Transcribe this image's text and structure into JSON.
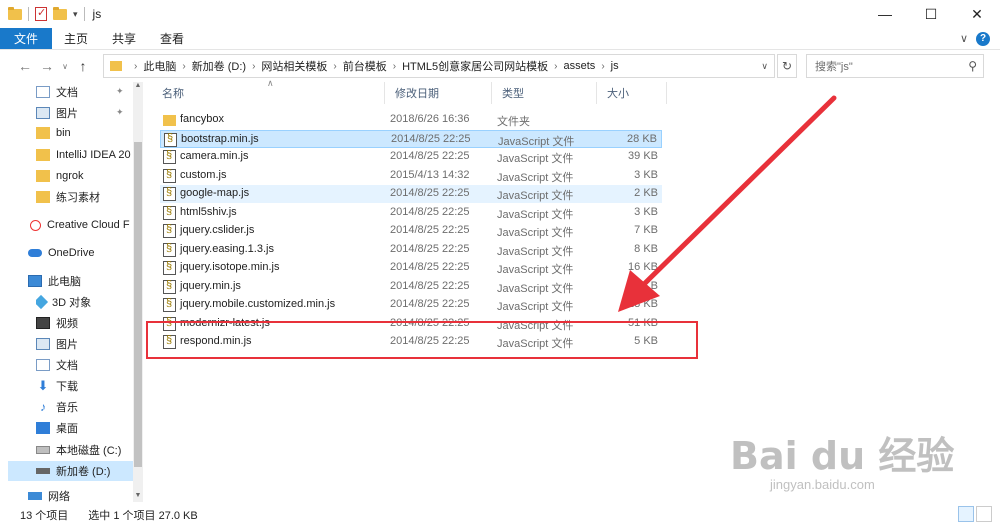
{
  "window": {
    "title": "js",
    "controls": {
      "minimize": "—",
      "maximize": "☐",
      "close": "✕"
    }
  },
  "ribbon": {
    "tabs": [
      "文件",
      "主页",
      "共享",
      "查看"
    ],
    "right_chevron": "∨",
    "help": "?"
  },
  "address": {
    "crumbs": [
      "此电脑",
      "新加卷 (D:)",
      "网站相关模板",
      "前台模板",
      "HTML5创意家居公司网站模板",
      "assets",
      "js"
    ],
    "search_placeholder": "搜索\"js\""
  },
  "sidebar": {
    "items": [
      {
        "label": "文档",
        "icon": "document-icon",
        "pinned": true
      },
      {
        "label": "图片",
        "icon": "pictures-icon",
        "pinned": true
      },
      {
        "label": "bin",
        "icon": "folder-icon"
      },
      {
        "label": "IntelliJ IDEA 20",
        "icon": "folder-icon"
      },
      {
        "label": "ngrok",
        "icon": "folder-icon"
      },
      {
        "label": "练习素材",
        "icon": "folder-icon"
      },
      {
        "label": "Creative Cloud F",
        "icon": "creative-cloud-icon"
      },
      {
        "label": "OneDrive",
        "icon": "onedrive-icon"
      },
      {
        "label": "此电脑",
        "icon": "this-pc-icon"
      },
      {
        "label": "3D 对象",
        "icon": "3d-objects-icon"
      },
      {
        "label": "视频",
        "icon": "videos-icon"
      },
      {
        "label": "图片",
        "icon": "pictures-icon"
      },
      {
        "label": "文档",
        "icon": "document-icon"
      },
      {
        "label": "下载",
        "icon": "downloads-icon"
      },
      {
        "label": "音乐",
        "icon": "music-icon"
      },
      {
        "label": "桌面",
        "icon": "desktop-icon"
      },
      {
        "label": "本地磁盘 (C:)",
        "icon": "drive-c-icon"
      },
      {
        "label": "新加卷 (D:)",
        "icon": "drive-d-icon",
        "selected": true
      },
      {
        "label": "网络",
        "icon": "network-icon"
      }
    ]
  },
  "columns": {
    "name": "名称",
    "modified": "修改日期",
    "type": "类型",
    "size": "大小"
  },
  "files": [
    {
      "name": "fancybox",
      "modified": "2018/6/26 16:36",
      "type": "文件夹",
      "size": "",
      "kind": "folder"
    },
    {
      "name": "bootstrap.min.js",
      "modified": "2014/8/25 22:25",
      "type": "JavaScript 文件",
      "size": "28 KB",
      "kind": "js",
      "state": "selected"
    },
    {
      "name": "camera.min.js",
      "modified": "2014/8/25 22:25",
      "type": "JavaScript 文件",
      "size": "39 KB",
      "kind": "js"
    },
    {
      "name": "custom.js",
      "modified": "2015/4/13 14:32",
      "type": "JavaScript 文件",
      "size": "3 KB",
      "kind": "js"
    },
    {
      "name": "google-map.js",
      "modified": "2014/8/25 22:25",
      "type": "JavaScript 文件",
      "size": "2 KB",
      "kind": "js",
      "state": "hover"
    },
    {
      "name": "html5shiv.js",
      "modified": "2014/8/25 22:25",
      "type": "JavaScript 文件",
      "size": "3 KB",
      "kind": "js"
    },
    {
      "name": "jquery.cslider.js",
      "modified": "2014/8/25 22:25",
      "type": "JavaScript 文件",
      "size": "7 KB",
      "kind": "js"
    },
    {
      "name": "jquery.easing.1.3.js",
      "modified": "2014/8/25 22:25",
      "type": "JavaScript 文件",
      "size": "8 KB",
      "kind": "js"
    },
    {
      "name": "jquery.isotope.min.js",
      "modified": "2014/8/25 22:25",
      "type": "JavaScript 文件",
      "size": "16 KB",
      "kind": "js"
    },
    {
      "name": "jquery.min.js",
      "modified": "2014/8/25 22:25",
      "type": "JavaScript 文件",
      "size": "93 KB",
      "kind": "js"
    },
    {
      "name": "jquery.mobile.customized.min.js",
      "modified": "2014/8/25 22:25",
      "type": "JavaScript 文件",
      "size": "13 KB",
      "kind": "js"
    },
    {
      "name": "modernizr-latest.js",
      "modified": "2014/8/25 22:25",
      "type": "JavaScript 文件",
      "size": "51 KB",
      "kind": "js"
    },
    {
      "name": "respond.min.js",
      "modified": "2014/8/25 22:25",
      "type": "JavaScript 文件",
      "size": "5 KB",
      "kind": "js"
    }
  ],
  "status": {
    "count": "13 个项目",
    "selected": "选中 1 个项目  27.0 KB"
  },
  "watermark": {
    "big": "Bai du 经验",
    "small": "jingyan.baidu.com"
  },
  "annotation_color": "#e8313a"
}
